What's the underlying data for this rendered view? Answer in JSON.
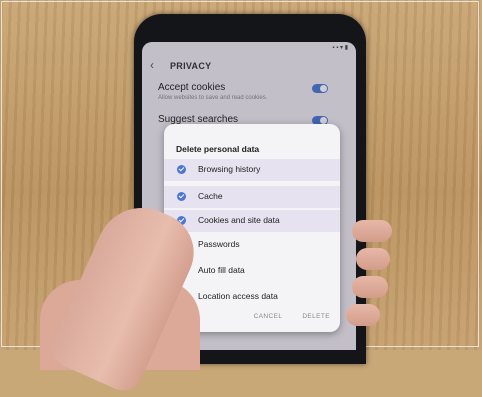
{
  "app": {
    "title": "PRIVACY"
  },
  "settings": [
    {
      "title": "Accept cookies",
      "subtitle": "Allow websites to save and read cookies.",
      "toggle_on": true
    },
    {
      "title": "Suggest searches",
      "subtitle": "",
      "toggle_on": true
    }
  ],
  "dialog": {
    "title": "Delete personal data",
    "options": [
      {
        "label": "Browsing history",
        "checked": true
      },
      {
        "label": "Cache",
        "checked": true
      },
      {
        "label": "Cookies and site data",
        "checked": true
      },
      {
        "label": "Passwords",
        "checked": false
      },
      {
        "label": "Auto fill data",
        "checked": false
      },
      {
        "label": "Location access data",
        "checked": false
      }
    ],
    "cancel_label": "CANCEL",
    "delete_label": "DELETE"
  },
  "colors": {
    "accent": "#4a77d6",
    "dialog_bg": "#f4f3f6",
    "screen_bg": "#eeeaf0"
  }
}
